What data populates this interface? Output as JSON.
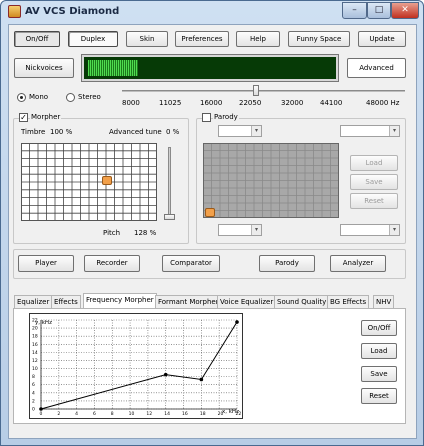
{
  "window": {
    "title": "AV VCS Diamond",
    "controls": [
      "–",
      "□",
      "✕"
    ]
  },
  "toolbar": {
    "onoff": "On/Off",
    "duplex": "Duplex",
    "skin": "Skin",
    "preferences": "Preferences",
    "help": "Help",
    "funny_space": "Funny Space",
    "update": "Update"
  },
  "nickvoices_label": "Nickvoices",
  "advanced_label": "Advanced",
  "mode": {
    "mono": "Mono",
    "stereo": "Stereo",
    "selected": "Mono"
  },
  "sample_rates": {
    "ticks": [
      "8000",
      "11025",
      "16000",
      "22050",
      "32000",
      "44100",
      "48000 Hz"
    ],
    "selected": "22050"
  },
  "morpher": {
    "title": "Morpher",
    "checked": true,
    "timbre_label": "Timbre",
    "timbre_value": "100 %",
    "adv_tune_label": "Advanced tune",
    "adv_tune_value": "0 %",
    "pitch_label": "Pitch",
    "pitch_value": "128 %"
  },
  "parody": {
    "title": "Parody",
    "checked": false,
    "load": "Load",
    "save": "Save",
    "reset": "Reset"
  },
  "modules": {
    "player": "Player",
    "recorder": "Recorder",
    "comparator": "Comparator",
    "parody": "Parody",
    "analyzer": "Analyzer"
  },
  "tabs": [
    "Equalizer",
    "Effects",
    "Frequency Morpher",
    "Formant Morpher",
    "Voice Equalizer",
    "Sound Quality",
    "BG Effects",
    "NHV"
  ],
  "active_tab": "Frequency Morpher",
  "freq_morpher": {
    "onoff": "On/Off",
    "load": "Load",
    "save": "Save",
    "reset": "Reset"
  },
  "chart_data": {
    "type": "line",
    "ylabel": "y, kHz",
    "xlabel": "x, kHz",
    "x_ticks": [
      "0",
      "2",
      "4",
      "6",
      "8",
      "10",
      "12",
      "14",
      "16",
      "18",
      "20",
      "22"
    ],
    "y_ticks": [
      "0",
      "2",
      "4",
      "6",
      "8",
      "10",
      "12",
      "14",
      "16",
      "18",
      "20",
      "22"
    ],
    "xlim": [
      0,
      22
    ],
    "ylim": [
      0,
      22
    ],
    "grid": true,
    "series": [
      {
        "x": [
          0,
          14,
          18,
          22
        ],
        "y": [
          0,
          8.5,
          7.3,
          21.5
        ]
      }
    ]
  },
  "colors": {
    "meter_bg": "#063a06",
    "meter_bar": "#37c937",
    "grid_bg": "#ffffff",
    "parody_grid_bg": "#a8a8a8"
  }
}
